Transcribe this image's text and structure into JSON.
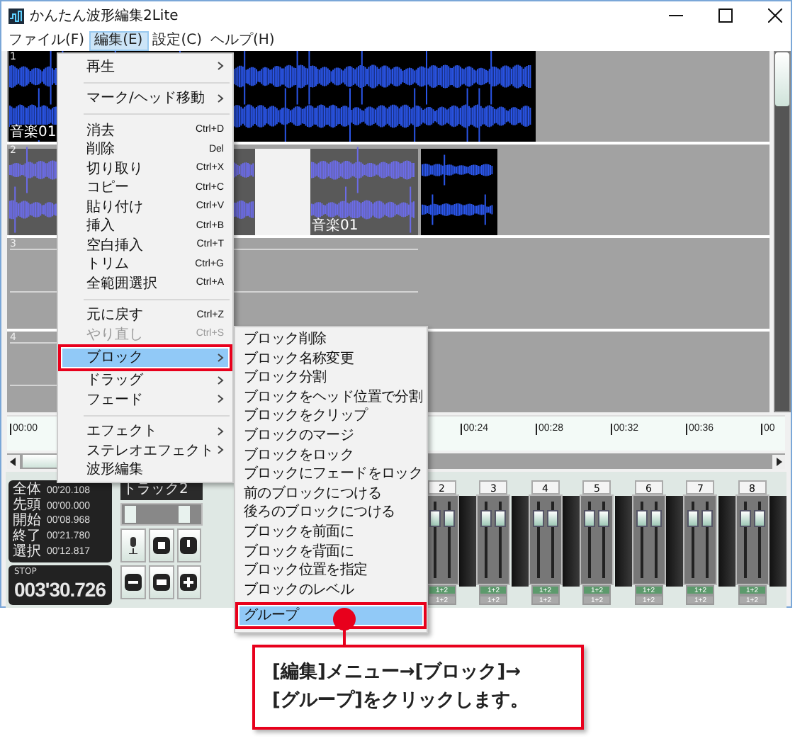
{
  "window": {
    "title": "かんたん波形編集2Lite"
  },
  "menubar": [
    {
      "label": "ファイル(F)",
      "selected": false
    },
    {
      "label": "編集(E)",
      "selected": true
    },
    {
      "label": "設定(C)",
      "selected": false
    },
    {
      "label": "ヘルプ(H)",
      "selected": false
    }
  ],
  "tracks": [
    {
      "number": "1",
      "block_label": "音楽01"
    },
    {
      "number": "2",
      "block_label": "音楽01"
    },
    {
      "number": "3"
    },
    {
      "number": "4"
    }
  ],
  "ruler": [
    "00:00",
    "00:24",
    "00:28",
    "00:32",
    "00:36",
    "00"
  ],
  "info": [
    {
      "label": "全体",
      "value": "00'20.108"
    },
    {
      "label": "先頭",
      "value": "00'00.000"
    },
    {
      "label": "開始",
      "value": "00'08.968"
    },
    {
      "label": "終了",
      "value": "00'21.780"
    },
    {
      "label": "選択",
      "value": "00'12.817"
    }
  ],
  "transport": {
    "state": "STOP",
    "time": "003'30.726"
  },
  "track_name": "トラック2",
  "selection_handles": [
    {
      "level": 0.05
    },
    {
      "level": 0.85
    }
  ],
  "mixer": [
    {
      "number": "2",
      "level": 0.85,
      "outputs": [
        "1+2",
        "1+2"
      ]
    },
    {
      "number": "3",
      "level": 0.85,
      "outputs": [
        "1+2",
        "1+2"
      ]
    },
    {
      "number": "4",
      "level": 0.85,
      "outputs": [
        "1+2",
        "1+2"
      ]
    },
    {
      "number": "5",
      "level": 0.85,
      "outputs": [
        "1+2",
        "1+2"
      ]
    },
    {
      "number": "6",
      "level": 0.85,
      "outputs": [
        "1+2",
        "1+2"
      ]
    },
    {
      "number": "7",
      "level": 0.85,
      "outputs": [
        "1+2",
        "1+2"
      ]
    },
    {
      "number": "8",
      "level": 0.85,
      "outputs": [
        "1+2",
        "1+2"
      ]
    }
  ],
  "edit_menu": [
    {
      "kind": "submenu",
      "label": "再生",
      "disabled": false,
      "selected": false
    },
    {
      "kind": "separator"
    },
    {
      "kind": "submenu",
      "label": "マーク/ヘッド移動",
      "disabled": false,
      "selected": false
    },
    {
      "kind": "separator"
    },
    {
      "kind": "item",
      "label": "消去",
      "shortcut": "Ctrl+D",
      "disabled": false,
      "selected": false
    },
    {
      "kind": "item",
      "label": "削除",
      "shortcut": "Del",
      "disabled": false,
      "selected": false
    },
    {
      "kind": "item",
      "label": "切り取り",
      "shortcut": "Ctrl+X",
      "disabled": false,
      "selected": false
    },
    {
      "kind": "item",
      "label": "コピー",
      "shortcut": "Ctrl+C",
      "disabled": false,
      "selected": false
    },
    {
      "kind": "item",
      "label": "貼り付け",
      "shortcut": "Ctrl+V",
      "disabled": false,
      "selected": false
    },
    {
      "kind": "item",
      "label": "挿入",
      "shortcut": "Ctrl+B",
      "disabled": false,
      "selected": false
    },
    {
      "kind": "item",
      "label": "空白挿入",
      "shortcut": "Ctrl+T",
      "disabled": false,
      "selected": false
    },
    {
      "kind": "item",
      "label": "トリム",
      "shortcut": "Ctrl+G",
      "disabled": false,
      "selected": false
    },
    {
      "kind": "item",
      "label": "全範囲選択",
      "shortcut": "Ctrl+A",
      "disabled": false,
      "selected": false
    },
    {
      "kind": "separator"
    },
    {
      "kind": "item",
      "label": "元に戻す",
      "shortcut": "Ctrl+Z",
      "disabled": false,
      "selected": false
    },
    {
      "kind": "item",
      "label": "やり直し",
      "shortcut": "Ctrl+S",
      "disabled": true,
      "selected": false
    },
    {
      "kind": "submenu",
      "label": "ブロック",
      "disabled": false,
      "selected": true
    },
    {
      "kind": "submenu",
      "label": "ドラッグ",
      "disabled": false,
      "selected": false
    },
    {
      "kind": "submenu",
      "label": "フェード",
      "disabled": false,
      "selected": false
    },
    {
      "kind": "separator"
    },
    {
      "kind": "submenu",
      "label": "エフェクト",
      "disabled": false,
      "selected": false
    },
    {
      "kind": "submenu",
      "label": "ステレオエフェクト",
      "disabled": false,
      "selected": false
    },
    {
      "kind": "item",
      "label": "波形編集",
      "disabled": false,
      "selected": false
    }
  ],
  "block_submenu": [
    {
      "label": "ブロック削除",
      "selected": false
    },
    {
      "label": "ブロック名称変更",
      "selected": false
    },
    {
      "label": "ブロック分割",
      "selected": false
    },
    {
      "label": "ブロックをヘッド位置で分割",
      "selected": false
    },
    {
      "label": "ブロックをクリップ",
      "selected": false
    },
    {
      "label": "ブロックのマージ",
      "selected": false
    },
    {
      "label": "ブロックをロック",
      "selected": false
    },
    {
      "label": "ブロックにフェードをロック",
      "selected": false
    },
    {
      "label": "前のブロックにつける",
      "selected": false
    },
    {
      "label": "後ろのブロックにつける",
      "selected": false
    },
    {
      "label": "ブロックを前面に",
      "selected": false
    },
    {
      "label": "ブロックを背面に",
      "selected": false
    },
    {
      "label": "ブロック位置を指定",
      "selected": false
    },
    {
      "label": "ブロックのレベル",
      "selected": false
    },
    {
      "label": "グループ",
      "selected": true
    }
  ],
  "callout": {
    "text": "[編集]メニュー→[ブロック]→\n[グループ]をクリックします。"
  }
}
